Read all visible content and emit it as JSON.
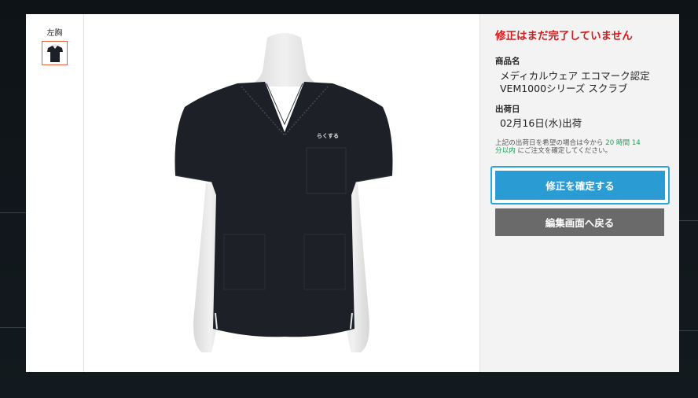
{
  "thumbnails": {
    "label": "左胸",
    "items": [
      {
        "icon": "scrub-shirt-thumbnail"
      }
    ]
  },
  "product_image": {
    "embroidery_text": "らくする",
    "garment_color": "#1d2127",
    "mannequin_color": "#e8e8e8"
  },
  "sidebar": {
    "warning": "修正はまだ完了していません",
    "product_name_label": "商品名",
    "product_name_line1": "メディカルウェア エコマーク認定",
    "product_name_line2": "VEM1000シリーズ スクラブ",
    "ship_date_label": "出荷日",
    "ship_date_value": "02月16日(水)出荷",
    "note_prefix": "上記の出荷日を希望の場合は今から",
    "note_highlight_1": "20 時間 14",
    "note_highlight_2": "分以内",
    "note_suffix": "にご注文を確定してください。",
    "confirm_button": "修正を確定する",
    "back_button": "編集画面へ戻る"
  },
  "colors": {
    "warning": "#d11c1c",
    "confirm": "#2b9bd3",
    "confirm_focus_ring": "#2aa6de",
    "back": "#6a6a6a",
    "countdown": "#27a05a",
    "thumb_selected_border": "#e2603b"
  }
}
